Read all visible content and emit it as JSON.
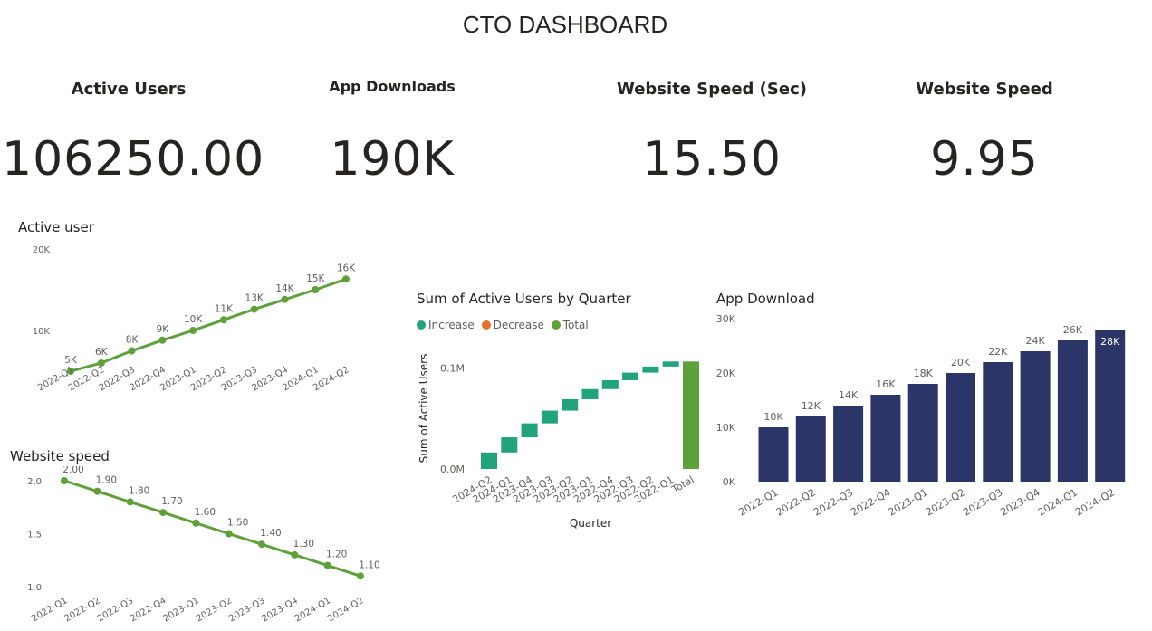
{
  "dashboard": {
    "title": "CTO DASHBOARD"
  },
  "kpis": [
    {
      "label": "Active Users",
      "value": "106250.00"
    },
    {
      "label": "App Downloads",
      "value": "190K"
    },
    {
      "label": "Website Speed (Sec)",
      "value": "15.50"
    },
    {
      "label": "Website Speed",
      "value": "9.95"
    }
  ],
  "colors": {
    "line": "#5ea03a",
    "bar": "#2c3567",
    "increase": "#21a37e",
    "decrease": "#e76f2e",
    "total": "#5ea03a"
  },
  "chart_data": [
    {
      "id": "active_user",
      "type": "line",
      "title": "Active user",
      "categories": [
        "2022-Q1",
        "2022-Q2",
        "2022-Q3",
        "2022-Q4",
        "2023-Q1",
        "2023-Q2",
        "2023-Q3",
        "2023-Q4",
        "2024-Q1",
        "2024-Q2"
      ],
      "values": [
        5000,
        6000,
        7500,
        8800,
        10000,
        11300,
        12600,
        13800,
        15000,
        16300
      ],
      "data_labels": [
        "5K",
        "6K",
        "8K",
        "9K",
        "10K",
        "11K",
        "13K",
        "14K",
        "15K",
        "16K"
      ],
      "yticks": [
        "10K",
        "20K"
      ],
      "ylim": [
        0,
        20000
      ],
      "grid": false
    },
    {
      "id": "website_speed",
      "type": "line",
      "title": "Website speed",
      "categories": [
        "2022-Q1",
        "2022-Q2",
        "2022-Q3",
        "2022-Q4",
        "2023-Q1",
        "2023-Q2",
        "2023-Q3",
        "2023-Q4",
        "2024-Q1",
        "2024-Q2"
      ],
      "values": [
        2.0,
        1.9,
        1.8,
        1.7,
        1.6,
        1.5,
        1.4,
        1.3,
        1.2,
        1.1
      ],
      "data_labels": [
        "2.00",
        "1.90",
        "1.80",
        "1.70",
        "1.60",
        "1.50",
        "1.40",
        "1.30",
        "1.20",
        "1.10"
      ],
      "yticks": [
        "1.0",
        "1.5",
        "2.0"
      ],
      "ylim": [
        1.0,
        2.0
      ],
      "grid": false
    },
    {
      "id": "waterfall",
      "type": "bar",
      "subtype": "waterfall",
      "title": "Sum of Active Users by Quarter",
      "xlabel": "Quarter",
      "ylabel": "Sum of Active Users",
      "legend": [
        "Increase",
        "Decrease",
        "Total"
      ],
      "legend_position": "top-left",
      "categories": [
        "2024-Q2",
        "2024-Q1",
        "2023-Q4",
        "2023-Q3",
        "2023-Q2",
        "2023-Q1",
        "2022-Q4",
        "2022-Q3",
        "2022-Q2",
        "2022-Q1",
        "Total"
      ],
      "values": [
        16300,
        15000,
        13800,
        12600,
        11300,
        10000,
        8800,
        7500,
        6000,
        5000,
        106300
      ],
      "yticks": [
        "0.0M",
        "0.1M"
      ],
      "ylim": [
        0,
        120000
      ],
      "grid": false
    },
    {
      "id": "app_download",
      "type": "bar",
      "title": "App Download",
      "categories": [
        "2022-Q1",
        "2022-Q2",
        "2022-Q3",
        "2022-Q4",
        "2023-Q1",
        "2023-Q2",
        "2023-Q3",
        "2023-Q4",
        "2024-Q1",
        "2024-Q2"
      ],
      "values": [
        10000,
        12000,
        14000,
        16000,
        18000,
        20000,
        22000,
        24000,
        26000,
        28000
      ],
      "data_labels": [
        "10K",
        "12K",
        "14K",
        "16K",
        "18K",
        "20K",
        "22K",
        "24K",
        "26K",
        "28K"
      ],
      "yticks": [
        "0K",
        "10K",
        "20K",
        "30K"
      ],
      "ylim": [
        0,
        30000
      ],
      "grid": false
    }
  ]
}
